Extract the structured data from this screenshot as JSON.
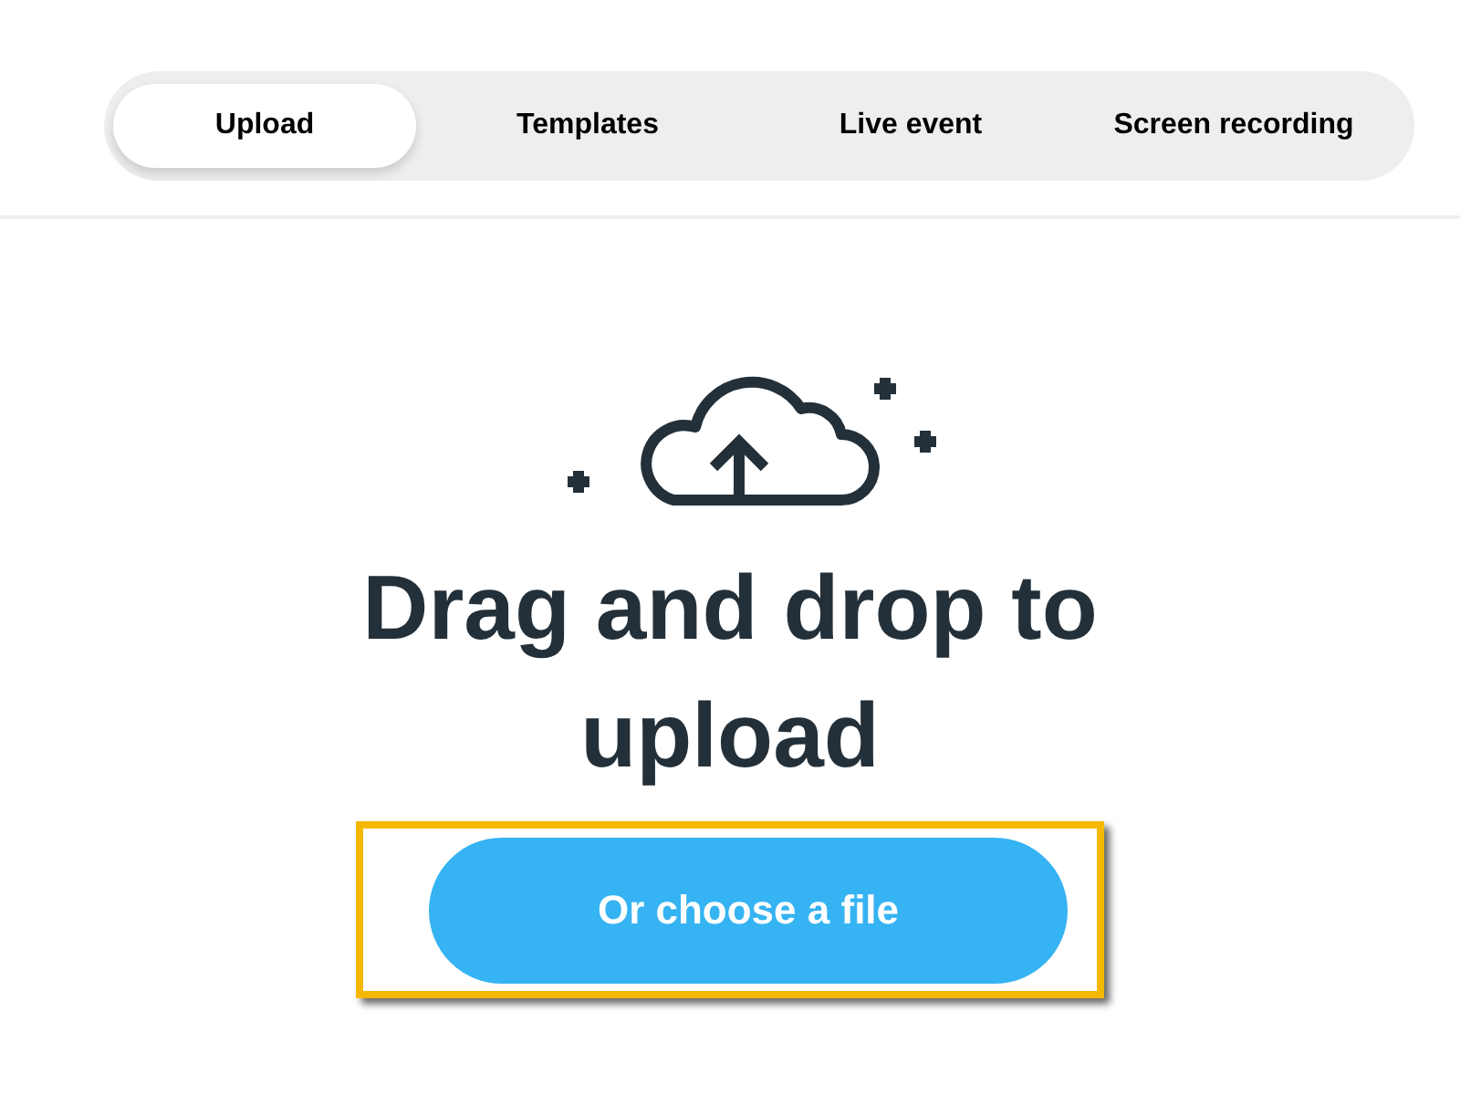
{
  "tabs": [
    {
      "label": "Upload",
      "selected": true
    },
    {
      "label": "Templates",
      "selected": false
    },
    {
      "label": "Live event",
      "selected": false
    },
    {
      "label": "Screen recording",
      "selected": false
    }
  ],
  "heading": "Drag and drop to upload",
  "upload_button": {
    "label": "Or choose a file",
    "highlighted": true
  }
}
